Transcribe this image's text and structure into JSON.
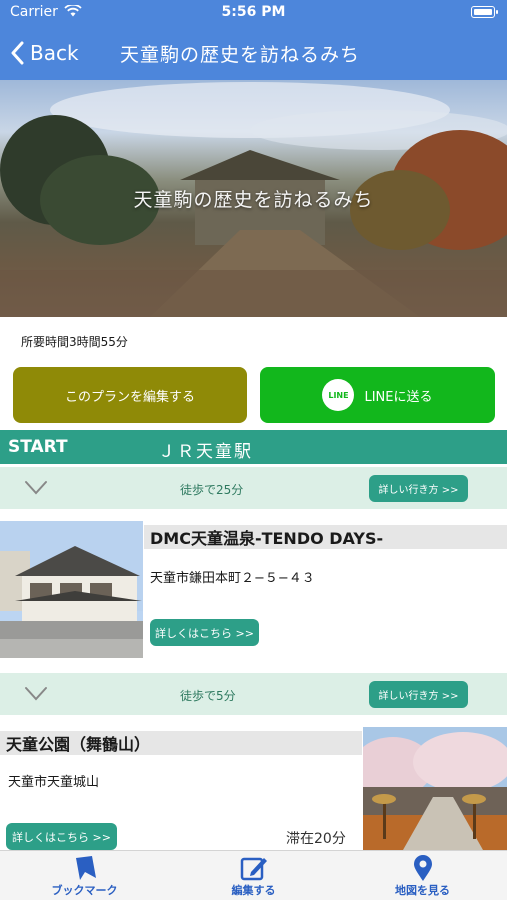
{
  "status_bar": {
    "carrier": "Carrier",
    "time": "5:56 PM"
  },
  "nav": {
    "back_label": "Back",
    "title": "天童駒の歴史を訪ねるみち"
  },
  "hero": {
    "title": "天童駒の歴史を訪ねるみち"
  },
  "plan": {
    "duration": "所要時間3時間55分",
    "edit_label": "このプランを編集する",
    "line_label": "LINEに送る",
    "line_logo_text": "LINE"
  },
  "start": {
    "label": "START",
    "station": "ＪＲ天童駅"
  },
  "routes": [
    {
      "text": "徒歩で25分",
      "button": "詳しい行き方 >>"
    },
    {
      "text": "徒歩で5分",
      "button": "詳しい行き方 >>"
    }
  ],
  "spots": [
    {
      "name": "DMC天童温泉-TENDO DAYS-",
      "address": "天童市鎌田本町２−５−４３",
      "detail_label": "詳しくはこちら >>"
    },
    {
      "name": "天童公園（舞鶴山）",
      "address": "天童市天童城山",
      "detail_label": "詳しくはこちら >>",
      "stay": "滞在20分"
    }
  ],
  "tabbar": {
    "items": [
      {
        "label": "ブックマーク",
        "icon": "bookmark-icon"
      },
      {
        "label": "編集する",
        "icon": "edit-icon"
      },
      {
        "label": "地図を見る",
        "icon": "map-pin-icon"
      }
    ]
  },
  "colors": {
    "nav_blue": "#4d86db",
    "edit_olive": "#8f8a07",
    "line_green": "#12b71c",
    "teal": "#2d9f88",
    "route_bg": "#dcefe6",
    "tab_blue": "#2a5fc2"
  }
}
